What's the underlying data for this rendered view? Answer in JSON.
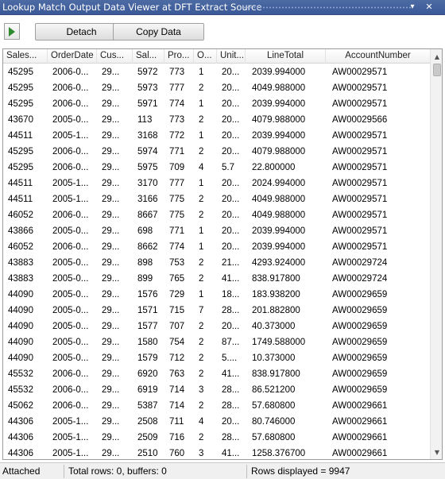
{
  "window": {
    "title": "Lookup Match Output Data Viewer at DFT Extract Source",
    "pin_glyph": "▾",
    "close_glyph": "✕"
  },
  "toolbar": {
    "play_icon": "play-icon",
    "detach_label": "Detach",
    "copy_label": "Copy Data"
  },
  "grid": {
    "columns": [
      "Sales...",
      "OrderDate",
      "Cus...",
      "Sal...",
      "Pro...",
      "O...",
      "Unit...",
      "LineTotal",
      "AccountNumber"
    ],
    "rows": [
      [
        "45295",
        "2006-0...",
        "29...",
        "5972",
        "773",
        "1",
        "20...",
        "2039.994000",
        "AW00029571"
      ],
      [
        "45295",
        "2006-0...",
        "29...",
        "5973",
        "777",
        "2",
        "20...",
        "4049.988000",
        "AW00029571"
      ],
      [
        "45295",
        "2006-0...",
        "29...",
        "5971",
        "774",
        "1",
        "20...",
        "2039.994000",
        "AW00029571"
      ],
      [
        "43670",
        "2005-0...",
        "29...",
        "113",
        "773",
        "2",
        "20...",
        "4079.988000",
        "AW00029566"
      ],
      [
        "44511",
        "2005-1...",
        "29...",
        "3168",
        "772",
        "1",
        "20...",
        "2039.994000",
        "AW00029571"
      ],
      [
        "45295",
        "2006-0...",
        "29...",
        "5974",
        "771",
        "2",
        "20...",
        "4079.988000",
        "AW00029571"
      ],
      [
        "45295",
        "2006-0...",
        "29...",
        "5975",
        "709",
        "4",
        "5.7",
        "22.800000",
        "AW00029571"
      ],
      [
        "44511",
        "2005-1...",
        "29...",
        "3170",
        "777",
        "1",
        "20...",
        "2024.994000",
        "AW00029571"
      ],
      [
        "44511",
        "2005-1...",
        "29...",
        "3166",
        "775",
        "2",
        "20...",
        "4049.988000",
        "AW00029571"
      ],
      [
        "46052",
        "2006-0...",
        "29...",
        "8667",
        "775",
        "2",
        "20...",
        "4049.988000",
        "AW00029571"
      ],
      [
        "43866",
        "2005-0...",
        "29...",
        "698",
        "771",
        "1",
        "20...",
        "2039.994000",
        "AW00029571"
      ],
      [
        "46052",
        "2006-0...",
        "29...",
        "8662",
        "774",
        "1",
        "20...",
        "2039.994000",
        "AW00029571"
      ],
      [
        "43883",
        "2005-0...",
        "29...",
        "898",
        "753",
        "2",
        "21...",
        "4293.924000",
        "AW00029724"
      ],
      [
        "43883",
        "2005-0...",
        "29...",
        "899",
        "765",
        "2",
        "41...",
        "838.917800",
        "AW00029724"
      ],
      [
        "44090",
        "2005-0...",
        "29...",
        "1576",
        "729",
        "1",
        "18...",
        "183.938200",
        "AW00029659"
      ],
      [
        "44090",
        "2005-0...",
        "29...",
        "1571",
        "715",
        "7",
        "28...",
        "201.882800",
        "AW00029659"
      ],
      [
        "44090",
        "2005-0...",
        "29...",
        "1577",
        "707",
        "2",
        "20...",
        "40.373000",
        "AW00029659"
      ],
      [
        "44090",
        "2005-0...",
        "29...",
        "1580",
        "754",
        "2",
        "87...",
        "1749.588000",
        "AW00029659"
      ],
      [
        "44090",
        "2005-0...",
        "29...",
        "1579",
        "712",
        "2",
        "5....",
        "10.373000",
        "AW00029659"
      ],
      [
        "45532",
        "2006-0...",
        "29...",
        "6920",
        "763",
        "2",
        "41...",
        "838.917800",
        "AW00029659"
      ],
      [
        "45532",
        "2006-0...",
        "29...",
        "6919",
        "714",
        "3",
        "28...",
        "86.521200",
        "AW00029659"
      ],
      [
        "45062",
        "2006-0...",
        "29...",
        "5387",
        "714",
        "2",
        "28...",
        "57.680800",
        "AW00029661"
      ],
      [
        "44306",
        "2005-1...",
        "29...",
        "2508",
        "711",
        "4",
        "20...",
        "80.746000",
        "AW00029661"
      ],
      [
        "44306",
        "2005-1...",
        "29...",
        "2509",
        "716",
        "2",
        "28...",
        "57.680800",
        "AW00029661"
      ],
      [
        "44306",
        "2005-1...",
        "29...",
        "2510",
        "760",
        "3",
        "41...",
        "1258.376700",
        "AW00029661"
      ]
    ]
  },
  "status": {
    "state": "Attached",
    "totals": "Total rows: 0, buffers: 0",
    "displayed": "Rows displayed = 9947"
  }
}
